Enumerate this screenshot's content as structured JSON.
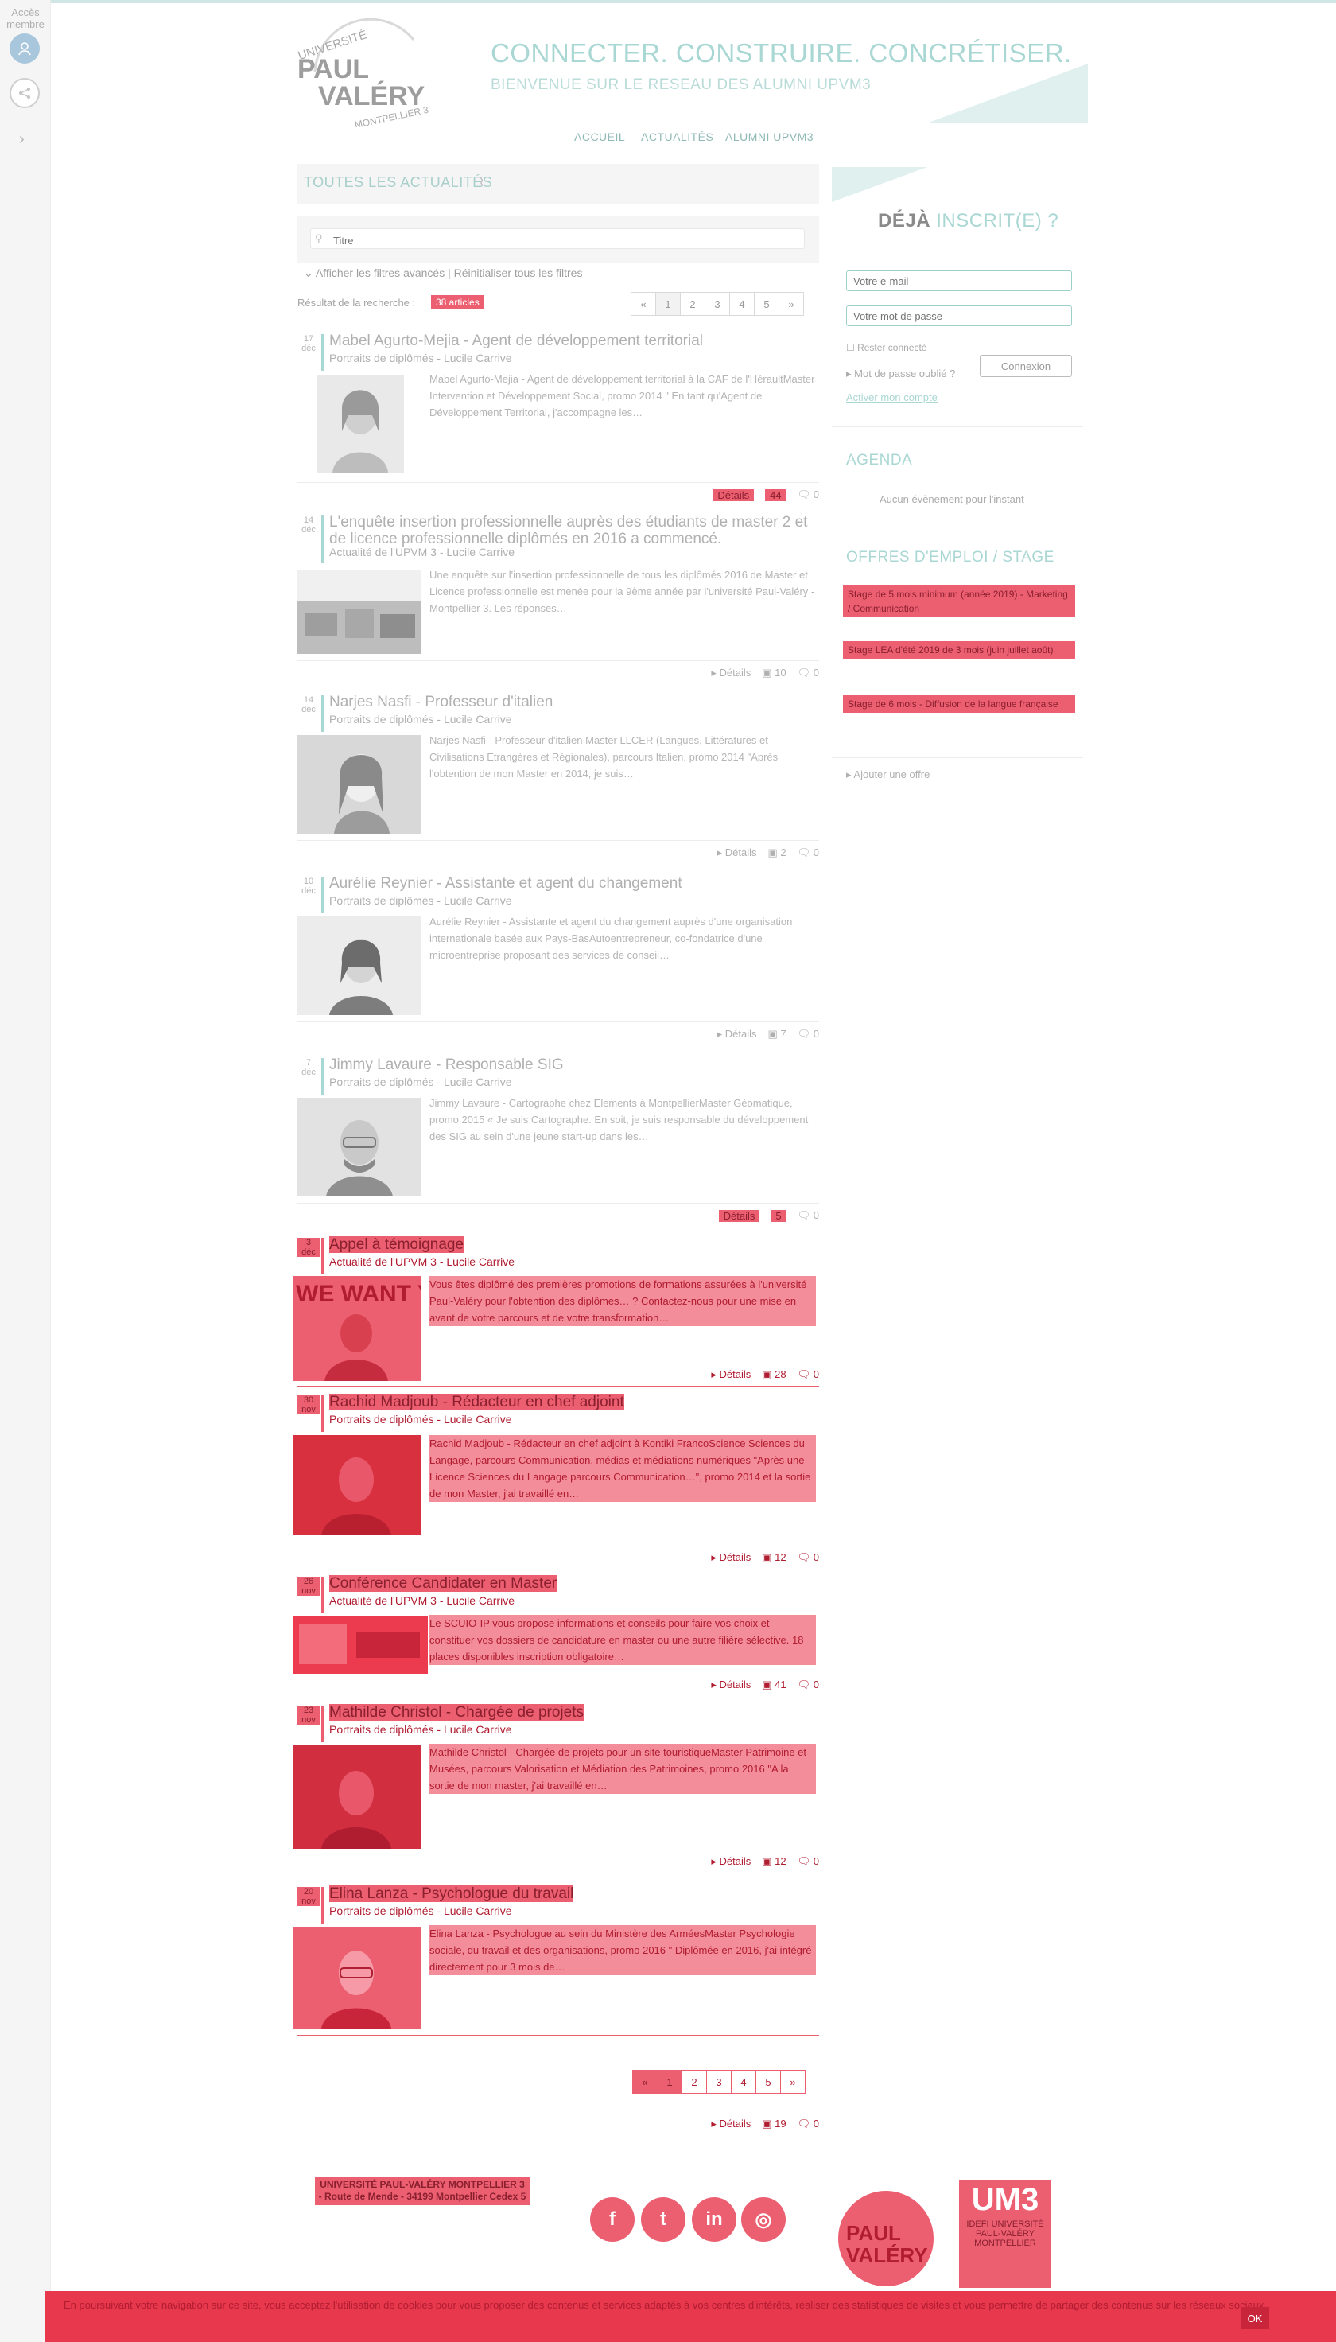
{
  "rail": {
    "member_label": "Accès membre",
    "expand_glyph": "›"
  },
  "header": {
    "logo_university": "UNIVERSITÉ",
    "logo_paul": "PAUL",
    "logo_valery": "VALÉRY",
    "logo_city": "MONTPELLIER 3",
    "slogan": "CONNECTER. CONSTRUIRE. CONCRÉTISER.",
    "subslogan": "BIENVENUE SUR LE RESEAU DES ALUMNI UPVM3"
  },
  "nav": [
    "ACCUEIL",
    "ACTUALITÉS",
    "ALUMNI UPVM3"
  ],
  "news": {
    "title": "TOUTES LES ACTUALITÉS",
    "rss_glyph": "⌇",
    "search_placeholder": "Titre",
    "filters": "⌄  Afficher les filtres avancés | Réinitialiser tous les filtres",
    "result_label": "Résultat de la recherche :",
    "result_count": "38 articles",
    "pager": [
      "«",
      "1",
      "2",
      "3",
      "4",
      "5",
      "»"
    ]
  },
  "articles": [
    {
      "day": "17",
      "month": "déc",
      "title": "Mabel Agurto-Mejia - Agent de développement territorial",
      "category": "Portraits de diplômés - Lucile Carrive",
      "excerpt": "Mabel Agurto-Mejia - Agent de développement territorial à la CAF de l'HéraultMaster Intervention et Développement Social, promo 2014 \" En tant qu'Agent de Développement Territorial, j'accompagne les…",
      "details": "Détails",
      "views": "44",
      "comments": "0"
    },
    {
      "day": "14",
      "month": "déc",
      "title": "L'enquête insertion professionnelle auprès des étudiants de master 2 et de licence professionnelle diplômés en 2016 a commencé.",
      "category": "Actualité de l'UPVM 3 - Lucile Carrive",
      "excerpt": "Une enquête sur l'insertion professionnelle de tous les diplômés 2016 de Master et Licence professionnelle est menée pour la 9ème année par l'université Paul-Valéry - Montpellier 3. Les réponses…",
      "details": "Détails",
      "views": "10",
      "comments": "0"
    },
    {
      "day": "14",
      "month": "déc",
      "title": "Narjes Nasfi - Professeur d'italien",
      "category": "Portraits de diplômés - Lucile Carrive",
      "excerpt": "Narjes Nasfi - Professeur d'italien Master LLCER (Langues, Littératures et Civilisations Etrangères et Régionales), parcours Italien, promo 2014 \"Après l'obtention de mon Master en 2014, je suis…",
      "details": "Détails",
      "views": "2",
      "comments": "0"
    },
    {
      "day": "10",
      "month": "déc",
      "title": "Aurélie Reynier - Assistante et agent du changement",
      "category": "Portraits de diplômés - Lucile Carrive",
      "excerpt": "Aurélie Reynier - Assistante et agent du changement auprès d'une organisation internationale basée aux Pays-BasAutoentrepreneur, co-fondatrice d'une microentreprise proposant des services de conseil…",
      "details": "Détails",
      "views": "7",
      "comments": "0"
    },
    {
      "day": "7",
      "month": "déc",
      "title": "Jimmy Lavaure - Responsable SIG",
      "category": "Portraits de diplômés - Lucile Carrive",
      "excerpt": "Jimmy Lavaure - Cartographe chez Elements à MontpellierMaster Géomatique, promo 2015 « Je suis Cartographe. En soit, je suis responsable du développement des SIG au sein d'une jeune start-up dans les…",
      "details": "Détails",
      "views": "5",
      "comments": "0"
    },
    {
      "day": "3",
      "month": "déc",
      "title": "Appel à témoignage",
      "category": "Actualité de l'UPVM 3 - Lucile Carrive",
      "excerpt": "Vous êtes diplômé des premières promotions de formations assurées à l'université Paul-Valéry pour l'obtention des diplômes… ? Contactez-nous pour une mise en avant de votre parcours et de votre transformation…",
      "details": "Détails",
      "views": "28",
      "comments": "0"
    },
    {
      "day": "30",
      "month": "nov",
      "title": "Rachid Madjoub - Rédacteur en chef adjoint",
      "category": "Portraits de diplômés - Lucile Carrive",
      "excerpt": "Rachid Madjoub - Rédacteur en chef adjoint à Kontiki FrancoScience Sciences du Langage, parcours Communication, médias et médiations numériques \"Après une Licence Sciences du Langage parcours Communication…\", promo 2014 et la sortie de mon Master, j'ai travaillé en…",
      "details": "Détails",
      "views": "12",
      "comments": "0"
    },
    {
      "day": "26",
      "month": "nov",
      "title": "Conférence Candidater en Master",
      "category": "Actualité de l'UPVM 3 - Lucile Carrive",
      "excerpt": "Le SCUIO-IP vous propose informations et conseils pour faire vos choix et constituer vos dossiers de candidature en master ou une autre filière sélective. 18 places disponibles inscription obligatoire…",
      "details": "Détails",
      "views": "41",
      "comments": "0"
    },
    {
      "day": "23",
      "month": "nov",
      "title": "Mathilde Christol - Chargée de projets",
      "category": "Portraits de diplômés - Lucile Carrive",
      "excerpt": "Mathilde Christol - Chargée de projets pour un site touristiqueMaster Patrimoine et Musées, parcours Valorisation et Médiation des Patrimoines, promo 2016 \"A la sortie de mon master, j'ai travaillé en…",
      "details": "Détails",
      "views": "12",
      "comments": "0"
    },
    {
      "day": "20",
      "month": "nov",
      "title": "Elina Lanza - Psychologue du travail",
      "category": "Portraits de diplômés - Lucile Carrive",
      "excerpt": "Elina Lanza - Psychologue au sein du Ministère des ArméesMaster Psychologie sociale, du travail et des organisations, promo 2016 \" Diplômée en 2016, j'ai intégré directement pour 3 mois de…",
      "details": "Détails",
      "views": "19",
      "comments": "0"
    }
  ],
  "sidebar": {
    "login_title_bold": "DÉJÀ",
    "login_title_rest": "INSCRIT(E) ?",
    "email_placeholder": "Votre e-mail",
    "password_placeholder": "Votre mot de passe",
    "remember": "Rester connecté",
    "forgot": "Mot de passe oublié ?",
    "connect": "Connexion",
    "activate": "Activer mon compte",
    "agenda_title": "AGENDA",
    "agenda_empty": "Aucun évènement pour l'instant",
    "jobs_title": "OFFRES D'EMPLOI / STAGE",
    "jobs": [
      "Stage de 5 mois minimum (année 2019) - Marketing / Communication",
      "Stage LEA d'été 2019 de 3 mois (juin juillet août)",
      "Stage de 6 mois - Diffusion de la langue française"
    ],
    "add_offer": "Ajouter une offre"
  },
  "footer": {
    "university": "UNIVERSITÉ PAUL-VALÉRY MONTPELLIER 3 - Route de Mende - 34199 Montpellier Cedex 5",
    "social": [
      "f",
      "t",
      "in",
      "◎"
    ],
    "umr_label": "IDEFI UNIVERSITÉ PAUL-VALÉRY MONTPELLIER"
  },
  "cookie": {
    "text": "En poursuivant votre navigation sur ce site, vous acceptez l'utilisation de cookies pour vous proposer des contenus et services adaptés à vos centres d'intérêts, réaliser des statistiques de visites et vous permettre de partager des contenus sur les réseaux sociaux.",
    "ok": "OK"
  },
  "colors": {
    "accent": "#a9d7d3",
    "highlight": "#ec5f71",
    "cookie_bar": "#e8384e"
  }
}
